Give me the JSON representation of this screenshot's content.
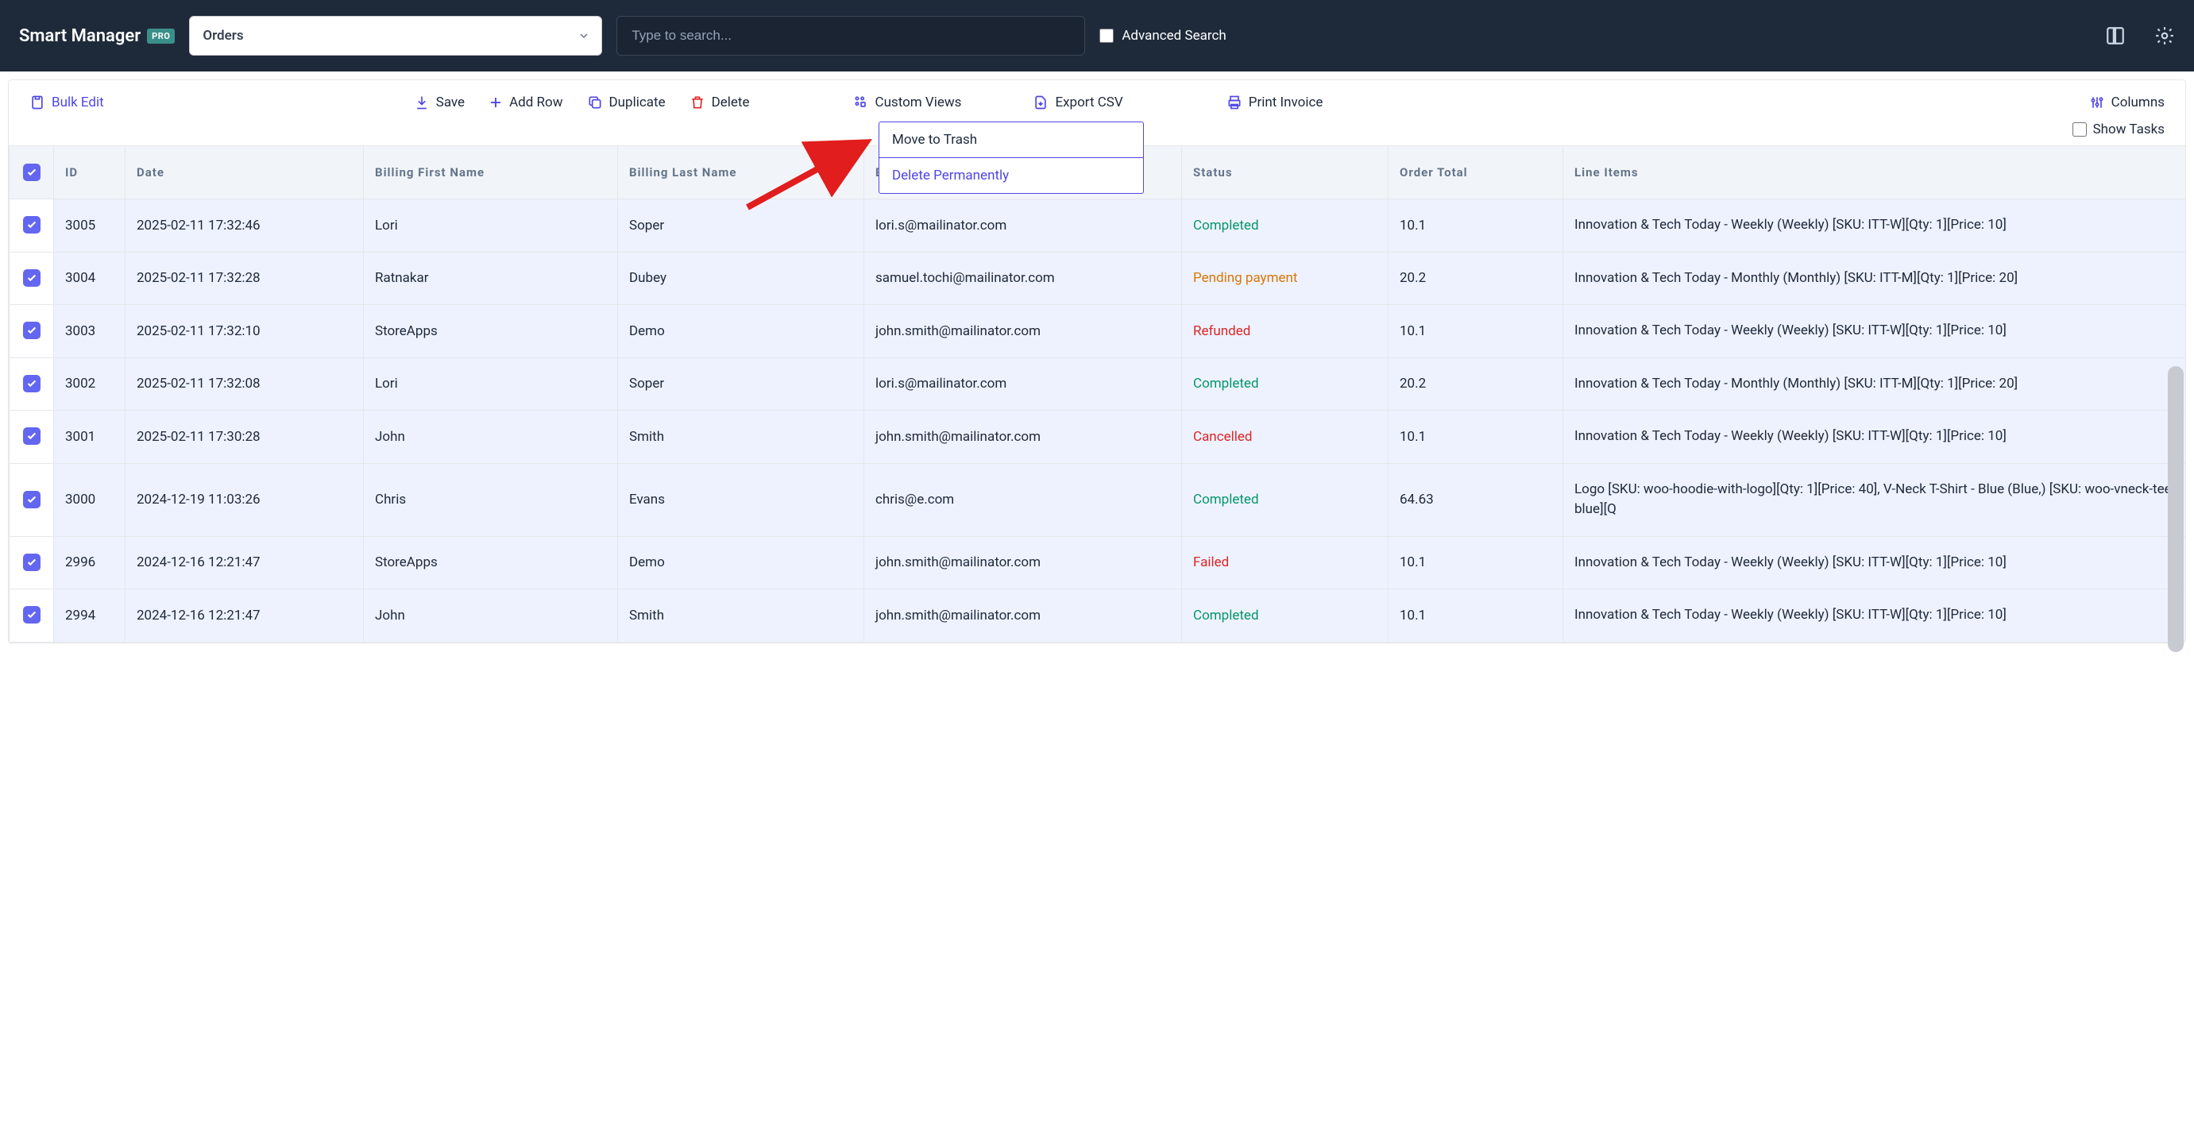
{
  "header": {
    "brand": "Smart Manager",
    "badge": "PRO",
    "dashboard_selected": "Orders",
    "search_placeholder": "Type to search...",
    "advanced_search_label": "Advanced Search"
  },
  "toolbar": {
    "bulk_edit": "Bulk Edit",
    "save": "Save",
    "add_row": "Add Row",
    "duplicate": "Duplicate",
    "delete": "Delete",
    "custom_views": "Custom Views",
    "export_csv": "Export CSV",
    "print_invoice": "Print Invoice",
    "columns": "Columns",
    "show_tasks": "Show Tasks"
  },
  "delete_menu": {
    "move_to_trash": "Move to Trash",
    "delete_permanently": "Delete Permanently"
  },
  "columns": [
    "ID",
    "Date",
    "Billing First Name",
    "Billing Last Name",
    "Billing Email",
    "Status",
    "Order Total",
    "Line Items"
  ],
  "status_classes": {
    "Completed": "status-completed",
    "Pending payment": "status-pending",
    "Refunded": "status-refunded",
    "Cancelled": "status-cancelled",
    "Failed": "status-failed"
  },
  "rows": [
    {
      "id": "3005",
      "date": "2025-02-11 17:32:46",
      "first": "Lori",
      "last": "Soper",
      "email": "lori.s@mailinator.com",
      "status": "Completed",
      "total": "10.1",
      "line": "Innovation & Tech Today - Weekly (Weekly) [SKU: ITT-W][Qty: 1][Price: 10]"
    },
    {
      "id": "3004",
      "date": "2025-02-11 17:32:28",
      "first": "Ratnakar",
      "last": "Dubey",
      "email": "samuel.tochi@mailinator.com",
      "status": "Pending payment",
      "total": "20.2",
      "line": "Innovation & Tech Today - Monthly (Monthly) [SKU: ITT-M][Qty: 1][Price: 20]"
    },
    {
      "id": "3003",
      "date": "2025-02-11 17:32:10",
      "first": "StoreApps",
      "last": "Demo",
      "email": "john.smith@mailinator.com",
      "status": "Refunded",
      "total": "10.1",
      "line": "Innovation & Tech Today - Weekly (Weekly) [SKU: ITT-W][Qty: 1][Price: 10]"
    },
    {
      "id": "3002",
      "date": "2025-02-11 17:32:08",
      "first": "Lori",
      "last": "Soper",
      "email": "lori.s@mailinator.com",
      "status": "Completed",
      "total": "20.2",
      "line": "Innovation & Tech Today - Monthly (Monthly) [SKU: ITT-M][Qty: 1][Price: 20]"
    },
    {
      "id": "3001",
      "date": "2025-02-11 17:30:28",
      "first": "John",
      "last": "Smith",
      "email": "john.smith@mailinator.com",
      "status": "Cancelled",
      "total": "10.1",
      "line": "Innovation & Tech Today - Weekly (Weekly) [SKU: ITT-W][Qty: 1][Price: 10]"
    },
    {
      "id": "3000",
      "date": "2024-12-19 11:03:26",
      "first": "Chris",
      "last": "Evans",
      "email": "chris@e.com",
      "status": "Completed",
      "total": "64.63",
      "line": "Logo [SKU: woo-hoodie-with-logo][Qty: 1][Price: 40], V-Neck T-Shirt - Blue (Blue,) [SKU: woo-vneck-tee-blue][Q"
    },
    {
      "id": "2996",
      "date": "2024-12-16 12:21:47",
      "first": "StoreApps",
      "last": "Demo",
      "email": "john.smith@mailinator.com",
      "status": "Failed",
      "total": "10.1",
      "line": "Innovation & Tech Today - Weekly (Weekly) [SKU: ITT-W][Qty: 1][Price: 10]"
    },
    {
      "id": "2994",
      "date": "2024-12-16 12:21:47",
      "first": "John",
      "last": "Smith",
      "email": "john.smith@mailinator.com",
      "status": "Completed",
      "total": "10.1",
      "line": "Innovation & Tech Today - Weekly (Weekly) [SKU: ITT-W][Qty: 1][Price: 10]"
    }
  ]
}
